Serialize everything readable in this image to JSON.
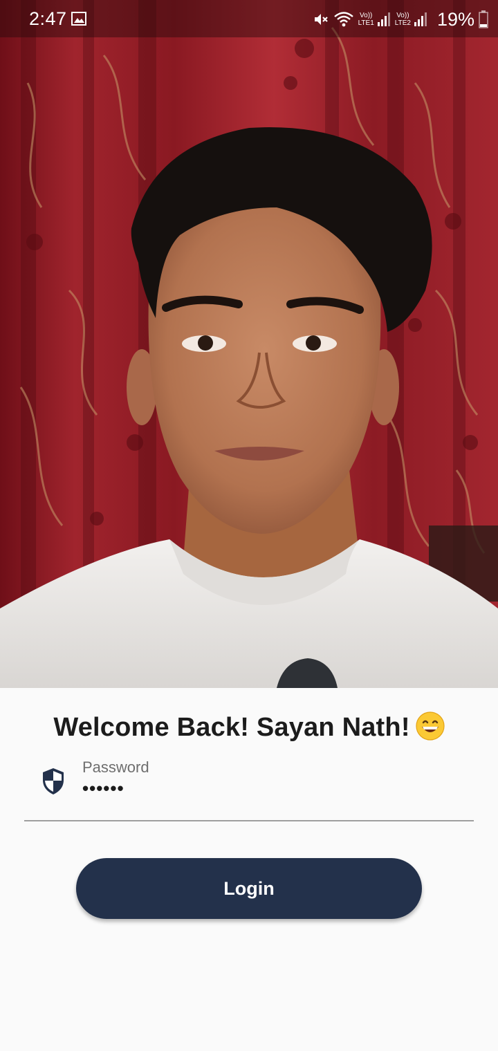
{
  "status_bar": {
    "time": "2:47",
    "gallery_icon": "image-icon",
    "sim1_label_top": "Vo))",
    "sim1_label_bottom": "LTE1",
    "sim2_label_top": "Vo))",
    "sim2_label_bottom": "LTE2",
    "battery_percent": "19%",
    "icons": [
      "mute-icon",
      "wifi-icon",
      "signal-icon",
      "battery-icon"
    ]
  },
  "profile_photo": {
    "icon": "profile-photo"
  },
  "login": {
    "welcome_text": "Welcome Back! Sayan Nath!",
    "emoji_icon": "grinning-face-emoji",
    "password_label": "Password",
    "password_value": "••••••",
    "field_icon": "shield-icon",
    "button_label": "Login"
  },
  "colors": {
    "button_background": "#23314b",
    "button_text": "#ffffff",
    "page_background": "#fafafa",
    "title_text": "#1c1c1c",
    "label_text": "#6e6e6e",
    "underline": "#9e9e9e",
    "shield": "#23314b"
  }
}
